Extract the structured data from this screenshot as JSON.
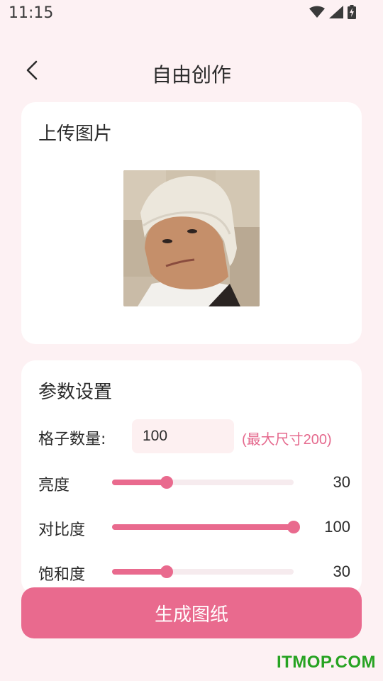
{
  "status_bar": {
    "time": "11:15",
    "icons": [
      "wifi-icon",
      "signal-icon",
      "battery-charging-icon"
    ]
  },
  "header": {
    "back_icon": "chevron-left-icon",
    "title": "自由创作"
  },
  "upload_card": {
    "title": "上传图片",
    "image": "uploaded-portrait-photo"
  },
  "params_card": {
    "title": "参数设置",
    "grid": {
      "label": "格子数量:",
      "value": "100",
      "hint": "(最大尺寸200)"
    },
    "sliders": [
      {
        "label": "亮度",
        "value": "30",
        "level": 0.3
      },
      {
        "label": "对比度",
        "value": "100",
        "level": 1.0
      },
      {
        "label": "饱和度",
        "value": "30",
        "level": 0.3
      }
    ]
  },
  "generate_button": {
    "label": "生成图纸"
  },
  "watermark": {
    "text": "ITMOP.COM"
  },
  "colors": {
    "background": "#fdf1f3",
    "accent": "#e96a8e",
    "card": "#ffffff",
    "input_bg": "#fdf0f1",
    "hint": "#e56a8e",
    "watermark": "#27a322"
  }
}
